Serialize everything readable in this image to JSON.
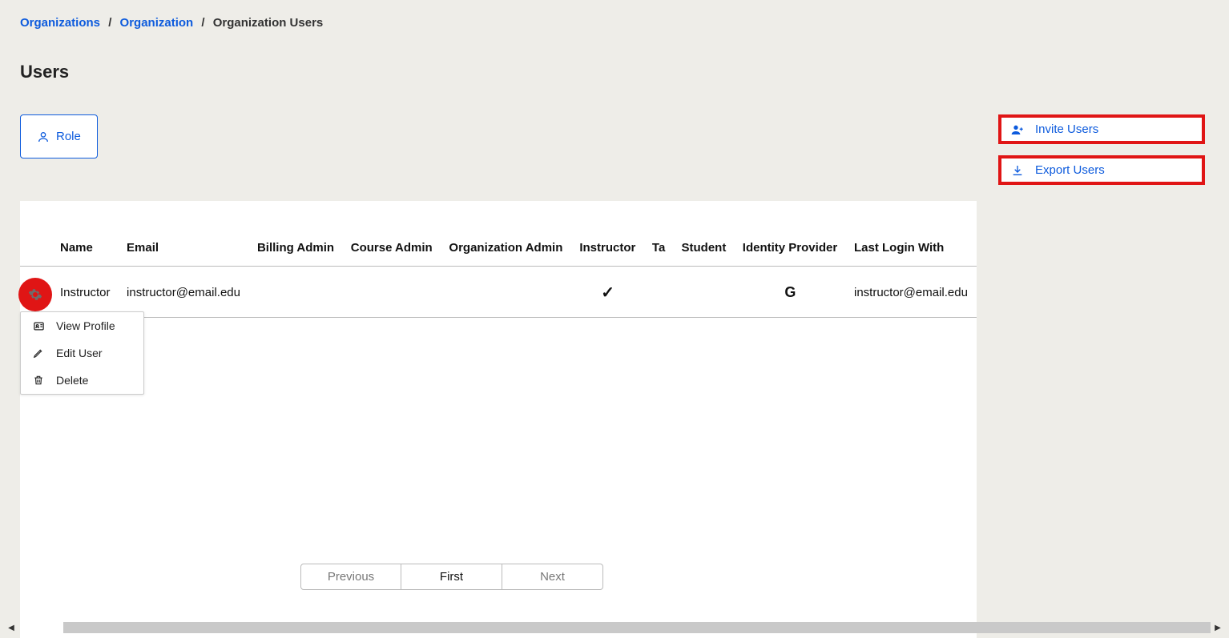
{
  "breadcrumb": {
    "items": [
      {
        "label": "Organizations",
        "link": true
      },
      {
        "label": "Organization",
        "link": true
      },
      {
        "label": "Organization Users",
        "link": false
      }
    ]
  },
  "pageTitle": "Users",
  "roleButton": {
    "label": "Role"
  },
  "sideActions": {
    "invite": {
      "label": "Invite Users"
    },
    "export": {
      "label": "Export Users"
    }
  },
  "table": {
    "headers": {
      "name": "Name",
      "email": "Email",
      "billingAdmin": "Billing Admin",
      "courseAdmin": "Course Admin",
      "orgAdmin": "Organization Admin",
      "instructor": "Instructor",
      "ta": "Ta",
      "student": "Student",
      "idp": "Identity Provider",
      "lastLogin": "Last Login With"
    },
    "rows": [
      {
        "name": "Instructor",
        "email": "instructor@email.edu",
        "billingAdmin": "",
        "courseAdmin": "",
        "orgAdmin": "",
        "instructor": "✓",
        "ta": "",
        "student": "",
        "idp": "G",
        "lastLogin": "instructor@email.edu"
      }
    ]
  },
  "contextMenu": {
    "viewProfile": "View Profile",
    "editUser": "Edit User",
    "delete": "Delete"
  },
  "pager": {
    "previous": "Previous",
    "first": "First",
    "next": "Next"
  }
}
